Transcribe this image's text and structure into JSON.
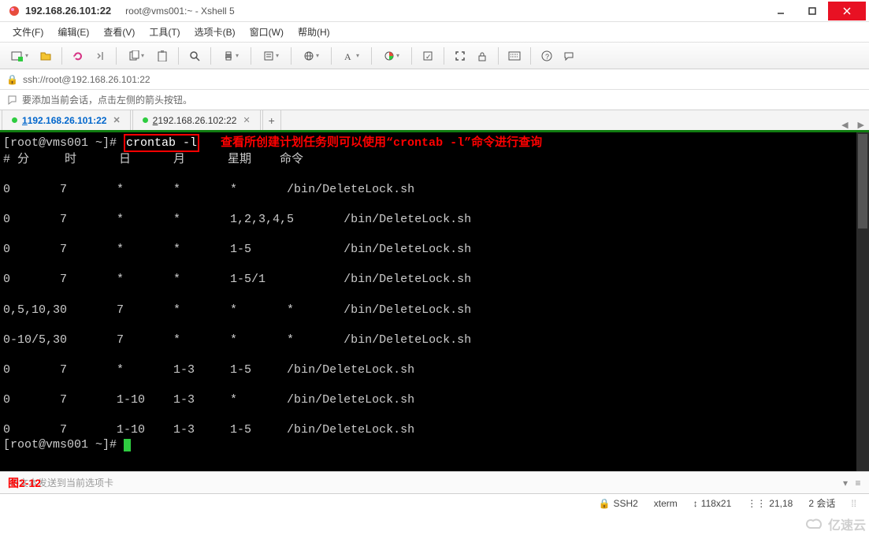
{
  "window": {
    "host": "192.168.26.101:22",
    "title_suffix": "root@vms001:~ - Xshell 5"
  },
  "menu": {
    "file": "文件(F)",
    "edit": "编辑(E)",
    "view": "查看(V)",
    "tools": "工具(T)",
    "tabs": "选项卡(B)",
    "window": "窗口(W)",
    "help": "帮助(H)"
  },
  "addressbar": {
    "url": "ssh://root@192.168.26.101:22"
  },
  "hint": {
    "text": "要添加当前会话，点击左侧的箭头按钮。"
  },
  "tabs": {
    "t1_prefix": "1",
    "t1_label": " 192.168.26.101:22",
    "t2_prefix": "2",
    "t2_label": " 192.168.26.102:22"
  },
  "terminal": {
    "prompt1": "[root@vms001 ~]# ",
    "command": "crontab -l",
    "annotation": "   查看所创建计划任务则可以使用“crontab -l”命令进行查询",
    "header": "# 分     时      日      月      星期    命令",
    "rows": [
      "0       7       *       *       *       /bin/DeleteLock.sh",
      "0       7       *       *       1,2,3,4,5       /bin/DeleteLock.sh",
      "0       7       *       *       1-5             /bin/DeleteLock.sh",
      "0       7       *       *       1-5/1           /bin/DeleteLock.sh",
      "0,5,10,30       7       *       *       *       /bin/DeleteLock.sh",
      "0-10/5,30       7       *       *       *       /bin/DeleteLock.sh",
      "0       7       *       1-3     1-5     /bin/DeleteLock.sh",
      "0       7       1-10    1-3     *       /bin/DeleteLock.sh",
      "0       7       1-10    1-3     1-5     /bin/DeleteLock.sh"
    ],
    "prompt2": "[root@vms001 ~]# "
  },
  "sendbar": {
    "placeholder": "将文本发送到当前选项卡",
    "figure": "图2-12"
  },
  "status": {
    "protocol": "SSH2",
    "term": "xterm",
    "size": "118x21",
    "cursor": "21,18",
    "sessions": "2 会话"
  },
  "watermark": "亿速云"
}
